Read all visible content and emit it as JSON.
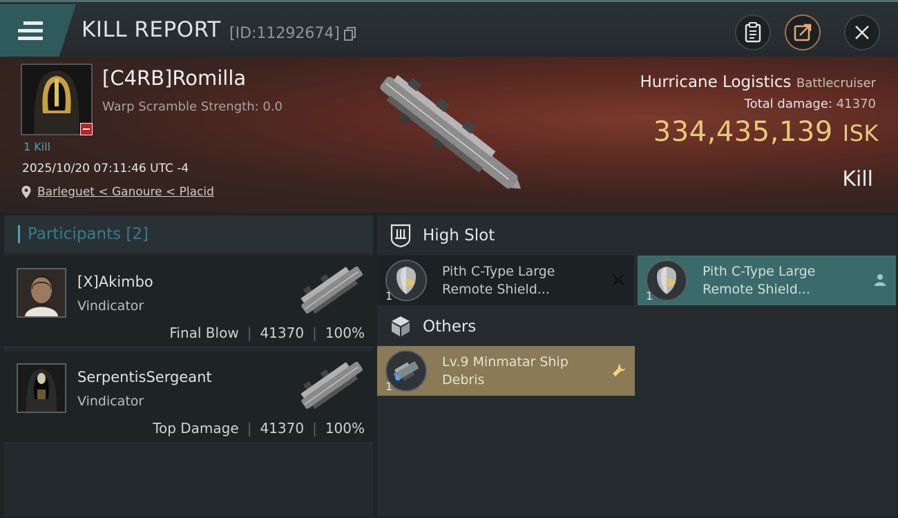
{
  "header": {
    "title": "KILL REPORT",
    "id_text": "[ID:11292674]"
  },
  "victim": {
    "name": "[C4RB]Romilla",
    "warp_scramble": "Warp Scramble Strength: 0.0",
    "kill_count": "1 Kill",
    "datetime": "2025/10/20 07:11:46 UTC -4",
    "location": "Barleguet < Ganoure < Placid"
  },
  "ship": {
    "name": "Hurricane Logistics",
    "class": "Battlecruiser",
    "total_damage_label": "Total damage:",
    "total_damage": "41370",
    "isk_value": "334,435,139",
    "isk_unit": "ISK",
    "result": "Kill"
  },
  "participants": {
    "label": "Participants",
    "count": "[2]",
    "items": [
      {
        "name": "[X]Akimbo",
        "ship": "Vindicator",
        "role": "Final Blow",
        "damage": "41370",
        "percent": "100%"
      },
      {
        "name": "SerpentisSergeant",
        "ship": "Vindicator",
        "role": "Top Damage",
        "damage": "41370",
        "percent": "100%"
      }
    ]
  },
  "sections": {
    "high_slot": {
      "label": "High Slot",
      "items": [
        {
          "name_line1": "Pith C-Type Large",
          "name_line2": "Remote Shield...",
          "qty": "1",
          "status": "destroyed"
        },
        {
          "name_line1": "Pith C-Type Large",
          "name_line2": "Remote Shield...",
          "qty": "1",
          "status": "dropped"
        }
      ]
    },
    "others": {
      "label": "Others",
      "items": [
        {
          "name_line1": "Lv.9 Minmatar Ship",
          "name_line2": "Debris",
          "qty": "1",
          "status": "salvage"
        }
      ]
    }
  },
  "colors": {
    "accent_teal": "#4fa3b3",
    "isk_gold": "#e8c97a",
    "dropped_bg": "#3a6b6a",
    "salvage_bg": "#8a7a55",
    "destroyed_bg": "#1c2124"
  },
  "icons": {
    "menu": "hamburger-icon",
    "copy": "copy-icon",
    "clipboard": "clipboard-icon",
    "share": "share-icon",
    "close": "close-icon",
    "location": "location-pin-icon",
    "high_slot": "high-slot-icon",
    "others": "cube-icon",
    "destroyed": "x-mark-icon",
    "dropped": "person-icon",
    "salvage": "wrench-icon"
  }
}
